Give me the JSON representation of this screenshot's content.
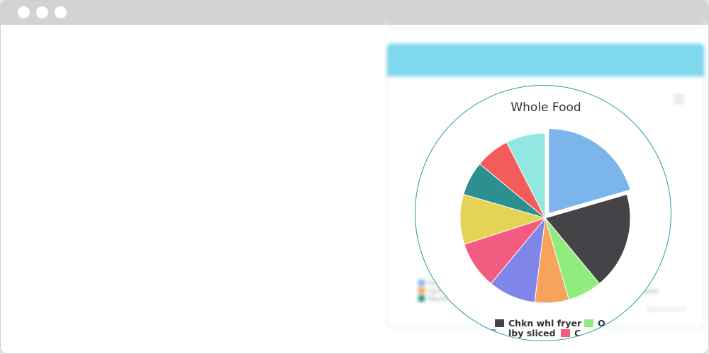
{
  "window": {
    "dots": [
      "dot",
      "dot",
      "dot"
    ]
  },
  "background_card": {
    "header_color": "#7fd8ee",
    "header_title": "",
    "credit": "Highcharts.com",
    "legend_entries": [
      {
        "label": "Pork ch...",
        "color": "#7cb5ec"
      },
      {
        "label": "Cg R Beef",
        "color": "#f7a35c"
      },
      {
        "label": "Rdsndl roastn...",
        "color": "#2b908f"
      },
      {
        "label": "...ng",
        "color": "#434348"
      },
      {
        "label": "Potatoes",
        "color": "#e4d354"
      }
    ]
  },
  "chart_data": {
    "type": "pie",
    "title": "Whole Food",
    "series": [
      {
        "name": "",
        "data": [
          {
            "label": "",
            "value": 20.5,
            "color": "#7cb5ec",
            "sliced": true
          },
          {
            "label": "Chkn whl fryer",
            "value": 18.5,
            "color": "#434348",
            "sliced": false
          },
          {
            "label": "",
            "value": 6.5,
            "color": "#90ed7d",
            "sliced": false
          },
          {
            "label": "",
            "value": 6.5,
            "color": "#f7a35c",
            "sliced": false
          },
          {
            "label": "",
            "value": 9.0,
            "color": "#8085e9",
            "sliced": false
          },
          {
            "label": "",
            "value": 9.0,
            "color": "#f15c80",
            "sliced": false
          },
          {
            "label": "",
            "value": 9.5,
            "color": "#e4d354",
            "sliced": false
          },
          {
            "label": "",
            "value": 6.5,
            "color": "#2b908f",
            "sliced": false
          },
          {
            "label": "",
            "value": 6.5,
            "color": "#f45b5b",
            "sliced": false
          },
          {
            "label": "",
            "value": 7.5,
            "color": "#91e8e1",
            "sliced": false
          }
        ]
      }
    ],
    "legend": [
      {
        "label": "Chkn whl fryer",
        "color": "#434348"
      },
      {
        "label": "O",
        "color": "#90ed7d"
      },
      {
        "label": "lby sliced",
        "color": "#8085e9"
      },
      {
        "label": "C",
        "color": "#f15c80"
      }
    ],
    "legend_position": "bottom"
  }
}
